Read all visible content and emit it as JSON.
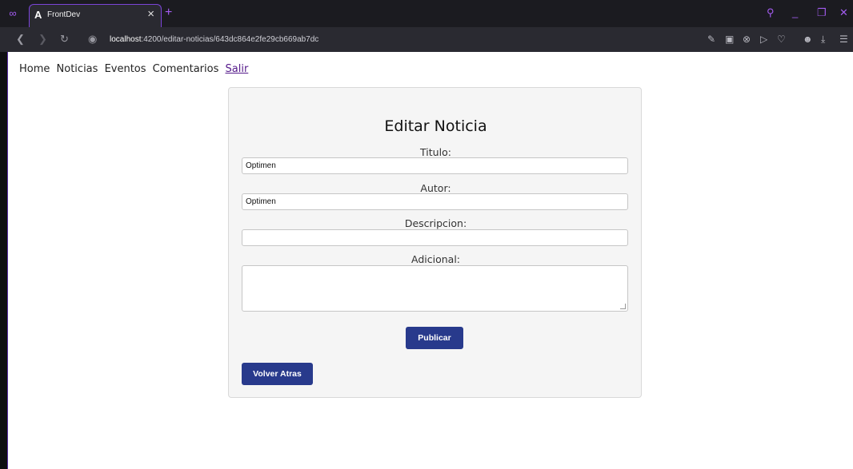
{
  "browser": {
    "tab_title": "FrontDev",
    "tab_favicon": "A",
    "tab_close": "×",
    "new_tab": "+",
    "url_host": "localhost",
    "url_rest": ":4200/editar-noticias/643dc864e2fe29cb669ab7dc",
    "icons": [
      "menu-icon",
      "back-icon",
      "forward-icon",
      "reload-icon",
      "site-info-icon",
      "edit-icon",
      "screenshot-icon",
      "adblock-icon",
      "send-icon",
      "heart-icon",
      "profile-icon",
      "download-icon",
      "settings-icon",
      "search-icon",
      "minimize-icon",
      "restore-icon",
      "close-window-icon"
    ],
    "accent_color": "#a35cf0"
  },
  "nav": {
    "home": "Home",
    "noticias": "Noticias",
    "eventos": "Eventos",
    "comentarios": "Comentarios",
    "salir": "Salir"
  },
  "form": {
    "title": "Editar Noticia",
    "titulo_label": "Titulo:",
    "titulo_value": "Optimen",
    "autor_label": "Autor:",
    "autor_value": "Optimen",
    "descripcion_label": "Descripcion:",
    "descripcion_value": "",
    "adicional_label": "Adicional:",
    "adicional_value": "",
    "publicar_label": "Publicar",
    "volver_label": "Volver Atras",
    "button_color": "#283a8c"
  }
}
